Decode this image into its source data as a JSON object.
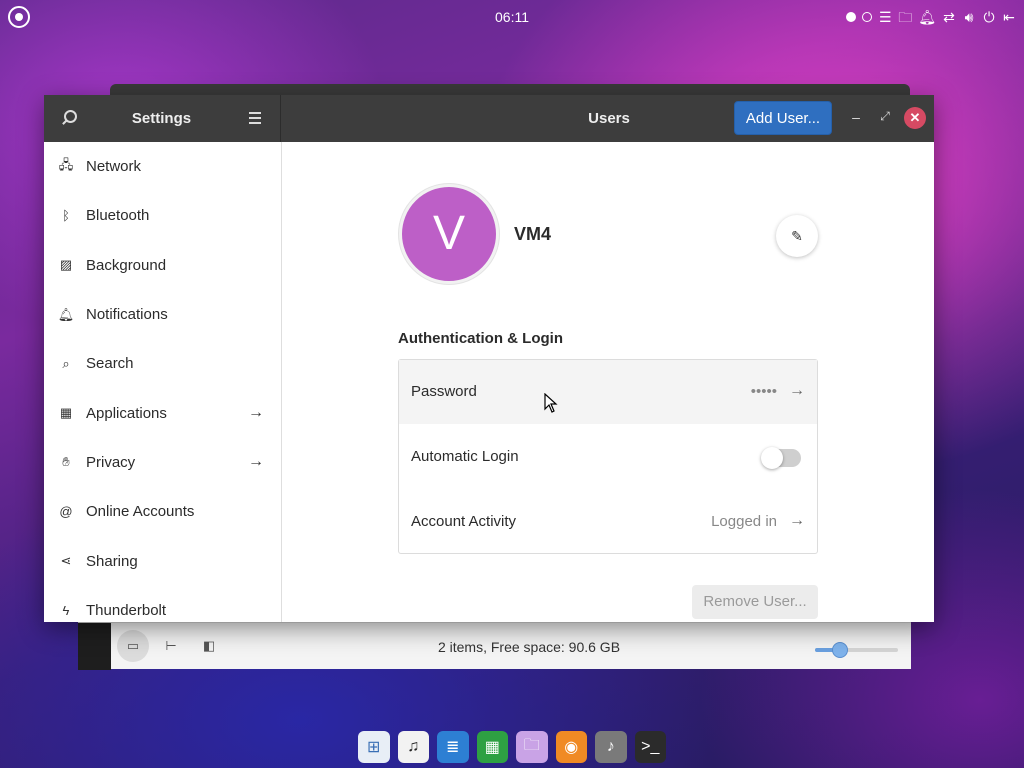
{
  "top_panel": {
    "clock": "06:11",
    "tray_icons": [
      "workspace-indicator-active",
      "workspace-indicator",
      "menu-icon",
      "folder-icon",
      "bell-icon",
      "network-icon",
      "volume-icon",
      "power-icon",
      "logout-icon"
    ]
  },
  "settings_window": {
    "header_title": "Settings",
    "page_title": "Users",
    "add_user_label": "Add User...",
    "sidebar": {
      "items": [
        {
          "label": "Network",
          "icon": "network-icon",
          "has_arrow": false
        },
        {
          "label": "Bluetooth",
          "icon": "bluetooth-icon",
          "has_arrow": false
        },
        {
          "label": "Background",
          "icon": "image-icon",
          "has_arrow": false
        },
        {
          "label": "Notifications",
          "icon": "bell-icon",
          "has_arrow": false
        },
        {
          "label": "Search",
          "icon": "search-icon",
          "has_arrow": false
        },
        {
          "label": "Applications",
          "icon": "grid-icon",
          "has_arrow": true
        },
        {
          "label": "Privacy",
          "icon": "hand-icon",
          "has_arrow": true
        },
        {
          "label": "Online Accounts",
          "icon": "at-icon",
          "has_arrow": false
        },
        {
          "label": "Sharing",
          "icon": "share-icon",
          "has_arrow": false
        },
        {
          "label": "Thunderbolt",
          "icon": "thunderbolt-icon",
          "has_arrow": false
        }
      ]
    },
    "user": {
      "avatar_letter": "V",
      "avatar_color": "#bd5fc7",
      "name": "VM4"
    },
    "auth_section_title": "Authentication & Login",
    "auth_rows": {
      "password": {
        "label": "Password",
        "value": "•••••"
      },
      "auto_login": {
        "label": "Automatic Login",
        "enabled": false
      },
      "activity": {
        "label": "Account Activity",
        "value": "Logged in"
      }
    },
    "remove_user_label": "Remove User..."
  },
  "file_manager": {
    "status_text": "2 items, Free space: 90.6 GB",
    "zoom_level": 0.3
  },
  "dock": {
    "items": [
      "apps-grid-icon",
      "music-icon",
      "text-editor-icon",
      "spreadsheet-icon",
      "files-icon",
      "firefox-icon",
      "media-icon",
      "terminal-icon"
    ]
  },
  "colors": {
    "accent": "#2f6fc0",
    "close": "#d64a63"
  }
}
